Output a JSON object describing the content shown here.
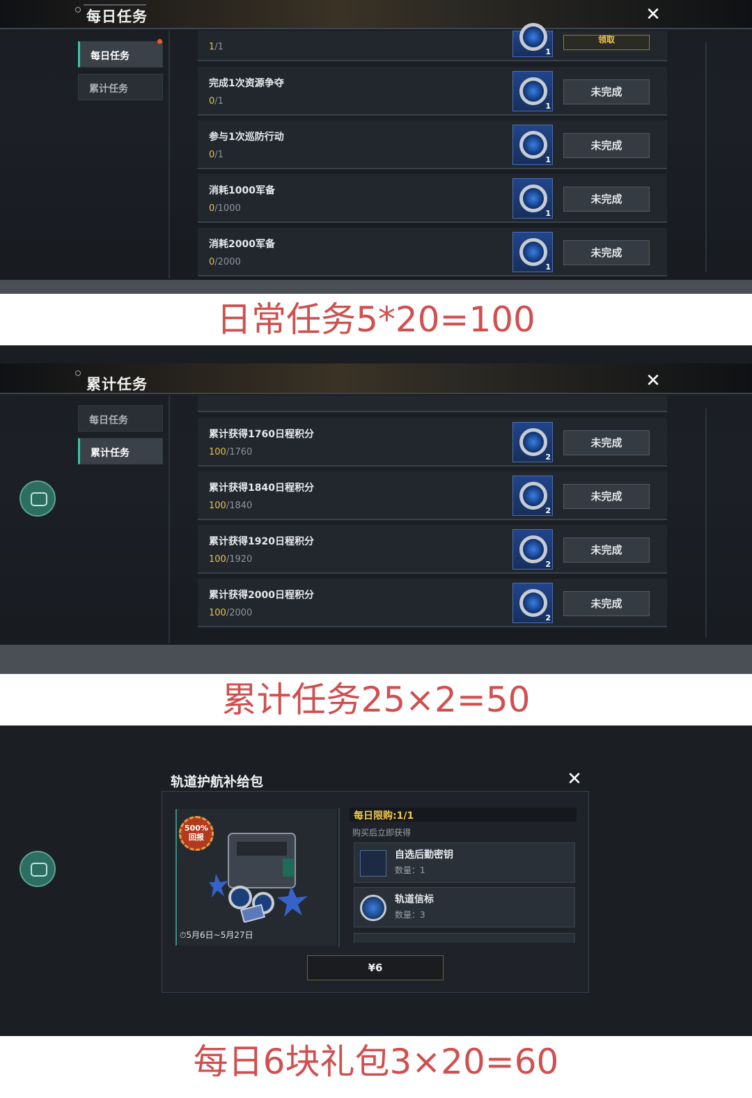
{
  "panel1": {
    "title": "每日任务",
    "tabs": [
      {
        "label": "每日任务"
      },
      {
        "label": "累计任务"
      }
    ],
    "partial_row": {
      "progress_cur": "1",
      "progress_total": "/1",
      "button": "领取"
    },
    "rows": [
      {
        "title": "完成1次资源争夺",
        "cur": "0",
        "total": "/1",
        "qty": "1",
        "status": "未完成"
      },
      {
        "title": "参与1次巡防行动",
        "cur": "0",
        "total": "/1",
        "qty": "1",
        "status": "未完成"
      },
      {
        "title": "消耗1000军备",
        "cur": "0",
        "total": "/1000",
        "qty": "1",
        "status": "未完成"
      },
      {
        "title": "消耗2000军备",
        "cur": "0",
        "total": "/2000",
        "qty": "1",
        "status": "未完成"
      }
    ]
  },
  "caption1": "日常任务5*20=100",
  "panel2": {
    "title": "累计任务",
    "tabs": [
      {
        "label": "每日任务"
      },
      {
        "label": "累计任务"
      }
    ],
    "rows": [
      {
        "title": "累计获得1760日程积分",
        "cur": "100",
        "total": "/1760",
        "qty": "2",
        "status": "未完成"
      },
      {
        "title": "累计获得1840日程积分",
        "cur": "100",
        "total": "/1840",
        "qty": "2",
        "status": "未完成"
      },
      {
        "title": "累计获得1920日程积分",
        "cur": "100",
        "total": "/1920",
        "qty": "2",
        "status": "未完成"
      },
      {
        "title": "累计获得2000日程积分",
        "cur": "100",
        "total": "/2000",
        "qty": "2",
        "status": "未完成"
      }
    ]
  },
  "caption2": "累计任务25×2=50",
  "shop": {
    "title": "轨道护航补给包",
    "badge_value": "500%",
    "badge_label": "回报",
    "period": "5月6日~5月27日",
    "limit": "每日限购:1/1",
    "note": "购买后立即获得",
    "items": [
      {
        "name": "自选后勤密钥",
        "count": "数量：1"
      },
      {
        "name": "轨道信标",
        "count": "数量：3"
      }
    ],
    "price": "¥6"
  },
  "caption3": "每日6块礼包3×20=60",
  "colors": {
    "accent": "#33c9a6",
    "caption": "#d04f4f",
    "highlight": "#e9c448"
  }
}
